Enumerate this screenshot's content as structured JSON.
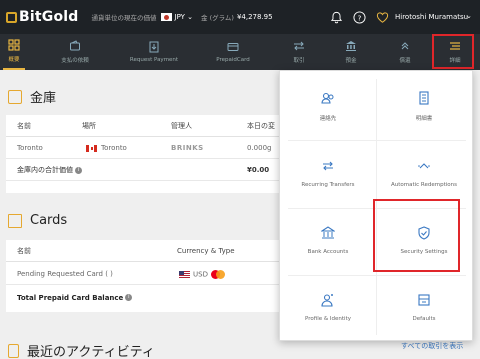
{
  "header": {
    "brand": "BitGold",
    "currency_label": "通貨単位の現在の価値",
    "currency_value": "JPY",
    "gold_label": "金 (グラム)",
    "gold_value": "¥4,278.95",
    "user_name": "Hirotoshi Muramatsu",
    "icons": [
      "bell-icon",
      "help-icon",
      "heart-icon"
    ],
    "accent": "#e8b642"
  },
  "nav": {
    "items": [
      {
        "label": "概要",
        "icon": "grid-icon",
        "active": true
      },
      {
        "label": "支払の依頼",
        "icon": "wallet-icon",
        "active": false
      },
      {
        "label": "Request Payment",
        "icon": "request-icon",
        "active": false
      },
      {
        "label": "PrepaidCard",
        "icon": "card-icon",
        "active": false
      },
      {
        "label": "取引",
        "icon": "transfer-icon",
        "active": false
      },
      {
        "label": "預金",
        "icon": "bank-icon",
        "active": false
      },
      {
        "label": "償還",
        "icon": "redeem-icon",
        "active": false
      },
      {
        "label": "詳細",
        "icon": "menu-icon",
        "active": false
      }
    ]
  },
  "vault": {
    "title": "金庫",
    "columns": [
      "名前",
      "場所",
      "管理人",
      "本日の変"
    ],
    "row": {
      "name": "Toronto",
      "location": "Toronto",
      "custodian": "BRINKS",
      "value": "0.000g"
    },
    "total_label": "金庫内の合計価値",
    "total_value": "¥0.00"
  },
  "cards": {
    "title": "Cards",
    "columns": [
      "名前",
      "Currency & Type"
    ],
    "row": {
      "name": "Pending Requested Card ( )",
      "currency": "USD"
    },
    "total_label": "Total Prepaid Card Balance"
  },
  "activity": {
    "title": "最近のアクティビティ",
    "link": "すべての取引を表示"
  },
  "dropdown": {
    "items": [
      {
        "label": "連絡先",
        "icon": "contacts-icon"
      },
      {
        "label": "明細書",
        "icon": "statement-icon"
      },
      {
        "label": "Recurring Transfers",
        "icon": "recurring-icon"
      },
      {
        "label": "Automatic Redemptions",
        "icon": "auto-redeem-icon"
      },
      {
        "label": "Bank Accounts",
        "icon": "bank-account-icon"
      },
      {
        "label": "Security Settings",
        "icon": "shield-icon"
      },
      {
        "label": "Profile & Identity",
        "icon": "profile-icon"
      },
      {
        "label": "Defaults",
        "icon": "defaults-icon"
      }
    ]
  }
}
